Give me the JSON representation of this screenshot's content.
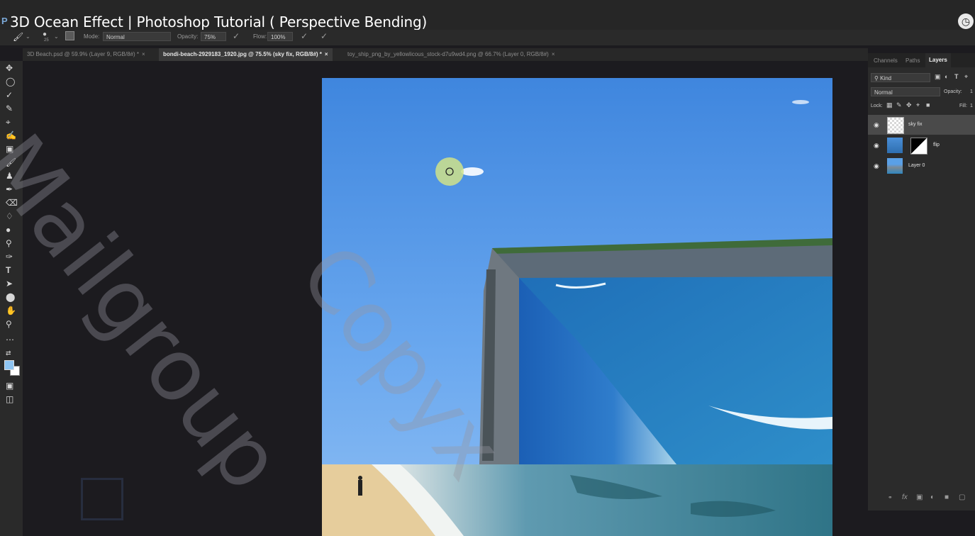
{
  "video": {
    "title": "3D Ocean Effect | Photoshop Tutorial ( Perspective Bending)",
    "ps_logo": "P"
  },
  "options": {
    "brush_size": "25",
    "mode_label": "Mode:",
    "mode_value": "Normal",
    "opacity_label": "Opacity:",
    "opacity_value": "75%",
    "flow_label": "Flow:",
    "flow_value": "100%"
  },
  "tabs": [
    {
      "label": "3D Beach.psd @ 59.9% (Layer 9, RGB/8#) *",
      "close": "×"
    },
    {
      "label": "bondi-beach-2929183_1920.jpg @ 75.5% (sky fix, RGB/8#) *",
      "close": "×"
    },
    {
      "label": "toy_ship_png_by_yellowlicous_stock-d7u9wd4.png @ 66.7% (Layer 0, RGB/8#)",
      "close": "×"
    }
  ],
  "panel": {
    "tabs": [
      "Channels",
      "Paths",
      "Layers"
    ],
    "kind_label": "Kind",
    "blend_mode": "Normal",
    "opacity_label": "Opacity:",
    "opacity_value": "1",
    "lock_label": "Lock:",
    "fill_label": "Fill:",
    "fill_value": "1",
    "layers": [
      {
        "name": "sky fix",
        "selected": true
      },
      {
        "name": "flip",
        "selected": false
      },
      {
        "name": "Layer 0",
        "selected": false
      }
    ]
  },
  "watermark": {
    "line1": "Mailgroup",
    "line2": "Copyx"
  },
  "colors": {
    "accent": "#3f87e0",
    "foreground_swatch": "#8ec4f2",
    "background_swatch": "#ffffff"
  }
}
